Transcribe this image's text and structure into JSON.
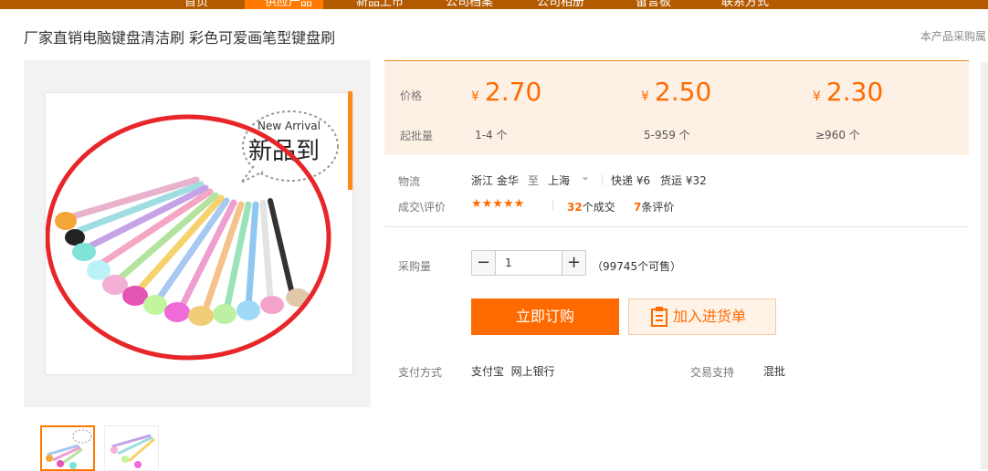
{
  "nav": {
    "items": [
      "首页",
      "供应产品",
      "新品上市",
      "公司档案",
      "公司相册",
      "留言板",
      "联系方式"
    ]
  },
  "product": {
    "title": "厂家直销电脑键盘清洁刷 彩色可爱画笔型键盘刷",
    "title_right": "本产品采购属"
  },
  "image": {
    "badge_en": "New Arrival",
    "badge_cn": "新品到"
  },
  "pricing": {
    "price_label": "价格",
    "moq_label": "起批量",
    "currency": "¥",
    "tiers": [
      {
        "price": "2.70",
        "range": "1-4 个"
      },
      {
        "price": "2.50",
        "range": "5-959 个"
      },
      {
        "price": "2.30",
        "range": "≥960 个"
      }
    ]
  },
  "logistics": {
    "label": "物流",
    "from": "浙江 金华",
    "to_word": "至",
    "to": "上海",
    "express": "快递 ¥6",
    "freight": "货运 ¥32"
  },
  "deals": {
    "label": "成交\\评价",
    "stars": "★★★★★",
    "deal_count": "32",
    "deal_suffix": "个成交",
    "review_count": "7",
    "review_suffix": "条评价"
  },
  "purchase": {
    "label": "采购量",
    "minus": "−",
    "plus": "+",
    "quantity": "1",
    "available": "（99745个可售）",
    "buy_label": "立即订购",
    "cart_label": "加入进货单"
  },
  "payment": {
    "label": "支付方式",
    "methods": "支付宝  网上银行",
    "support_label": "交易支持",
    "support_value": "混批"
  },
  "colors": {
    "accent": "#ff6a00",
    "nav_bg": "#b35a00",
    "price_bg": "#fdf0e5"
  }
}
